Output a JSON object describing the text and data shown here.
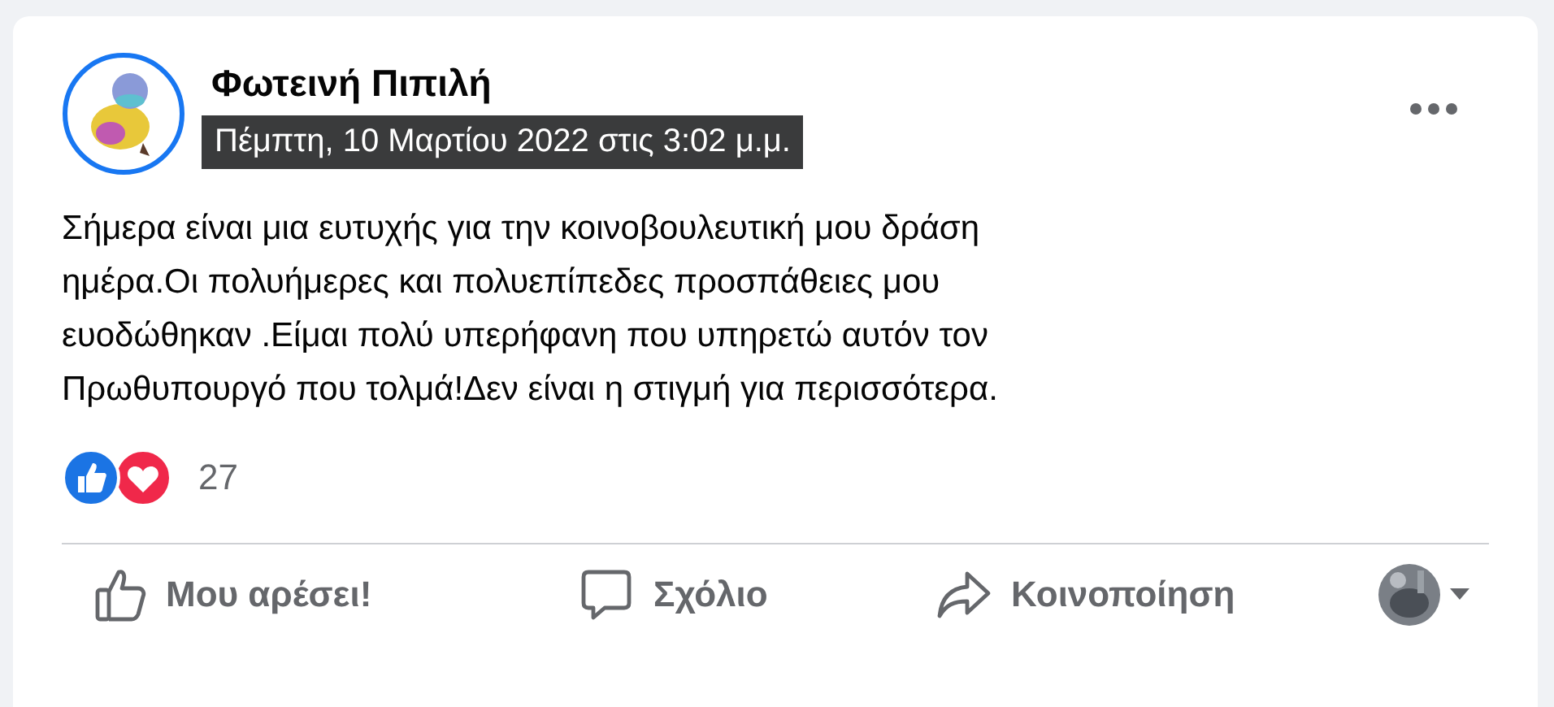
{
  "post": {
    "author": "Φωτεινή Πιπιλή",
    "timestamp_tooltip": "Πέμπτη, 10 Μαρτίου 2022 στις 3:02 μ.μ.",
    "text_lines": [
      "Σήμερα είναι μια ευτυχής για την κοινοβουλευτική μου δράση",
      "ημέρα.Οι πολυήμερες και πολυεπίπεδες προσπάθειες μου",
      "ευοδώθηκαν .Είμαι πολύ υπερήφανη που υπηρετώ αυτόν τον",
      "Πρωθυπουργό που τολμά!Δεν είναι η στιγμή για περισσότερα."
    ],
    "reaction_count": "27",
    "actions": [
      {
        "kind": "like",
        "label": "Μου αρέσει!"
      },
      {
        "kind": "comment",
        "label": "Σχόλιο"
      },
      {
        "kind": "share",
        "label": "Κοινοποίηση"
      }
    ]
  }
}
